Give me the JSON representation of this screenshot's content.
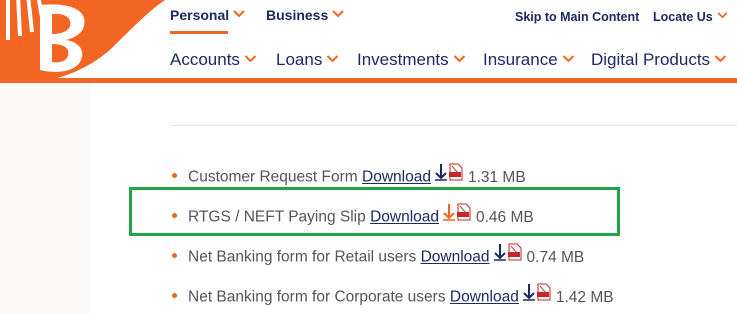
{
  "colors": {
    "brand_orange": "#f26522",
    "navy": "#1b2a63",
    "highlight_green": "#21a44a",
    "text_gray": "#555555"
  },
  "topnav": {
    "personal": "Personal",
    "business": "Business"
  },
  "utility": {
    "skip": "Skip to Main Content",
    "locate": "Locate Us"
  },
  "mainnav": {
    "items": [
      "Accounts",
      "Loans",
      "Investments",
      "Insurance",
      "Digital Products"
    ]
  },
  "forms": [
    {
      "name": "Customer Request Form",
      "link": "Download",
      "size": "1.31 MB"
    },
    {
      "name": "RTGS / NEFT Paying Slip",
      "link": "Download",
      "size": "0.46 MB",
      "highlighted": true
    },
    {
      "name": "Net Banking form for Retail users",
      "link": "Download",
      "size": "0.74 MB"
    },
    {
      "name": "Net Banking form for Corporate users",
      "link": "Download",
      "size": "1.42 MB"
    }
  ],
  "icons": {
    "download": "download-arrow-icon",
    "pdf": "pdf-file-icon",
    "caret": "chevron-down-icon"
  }
}
